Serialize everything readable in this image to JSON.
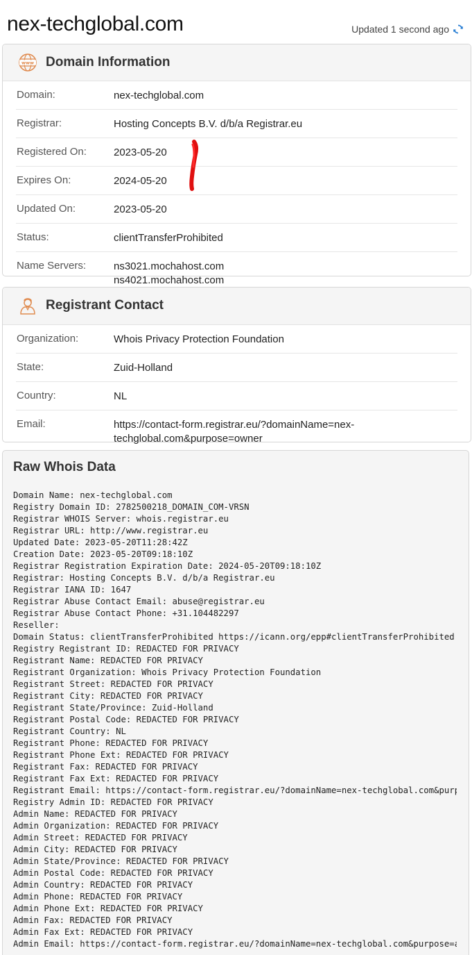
{
  "header": {
    "domain": "nex-techglobal.com",
    "updated_text": "Updated 1 second ago",
    "refresh_icon": "refresh-icon",
    "accent_color": "#2a7fd4"
  },
  "domain_info": {
    "title": "Domain Information",
    "icon": "www-globe-icon",
    "rows": [
      {
        "label": "Domain:",
        "value": "nex-techglobal.com"
      },
      {
        "label": "Registrar:",
        "value": "Hosting Concepts B.V. d/b/a Registrar.eu"
      },
      {
        "label": "Registered On:",
        "value": "2023-05-20"
      },
      {
        "label": "Expires On:",
        "value": "2024-05-20"
      },
      {
        "label": "Updated On:",
        "value": "2023-05-20"
      },
      {
        "label": "Status:",
        "value": "clientTransferProhibited"
      },
      {
        "label": "Name Servers:",
        "value": "ns3021.mochahost.com",
        "value2": "ns4021.mochahost.com"
      }
    ]
  },
  "registrant": {
    "title": "Registrant Contact",
    "icon": "user-icon",
    "rows": [
      {
        "label": "Organization:",
        "value": "Whois Privacy Protection Foundation"
      },
      {
        "label": "State:",
        "value": "Zuid-Holland"
      },
      {
        "label": "Country:",
        "value": "NL"
      },
      {
        "label": "Email:",
        "value": "https://contact-form.registrar.eu/?domainName=nex-",
        "value2": "techglobal.com&purpose=owner"
      }
    ]
  },
  "raw": {
    "title": "Raw Whois Data",
    "lines": [
      "Domain Name: nex-techglobal.com",
      "Registry Domain ID: 2782500218_DOMAIN_COM-VRSN",
      "Registrar WHOIS Server: whois.registrar.eu",
      "Registrar URL: http://www.registrar.eu",
      "Updated Date: 2023-05-20T11:28:42Z",
      "Creation Date: 2023-05-20T09:18:10Z",
      "Registrar Registration Expiration Date: 2024-05-20T09:18:10Z",
      "Registrar: Hosting Concepts B.V. d/b/a Registrar.eu",
      "Registrar IANA ID: 1647",
      "Registrar Abuse Contact Email: abuse@registrar.eu",
      "Registrar Abuse Contact Phone: +31.104482297",
      "Reseller:",
      "Domain Status: clientTransferProhibited https://icann.org/epp#clientTransferProhibited",
      "Registry Registrant ID: REDACTED FOR PRIVACY",
      "Registrant Name: REDACTED FOR PRIVACY",
      "Registrant Organization: Whois Privacy Protection Foundation",
      "Registrant Street: REDACTED FOR PRIVACY",
      "Registrant City: REDACTED FOR PRIVACY",
      "Registrant State/Province: Zuid-Holland",
      "Registrant Postal Code: REDACTED FOR PRIVACY",
      "Registrant Country: NL",
      "Registrant Phone: REDACTED FOR PRIVACY",
      "Registrant Phone Ext: REDACTED FOR PRIVACY",
      "Registrant Fax: REDACTED FOR PRIVACY",
      "Registrant Fax Ext: REDACTED FOR PRIVACY",
      "Registrant Email: https://contact-form.registrar.eu/?domainName=nex-techglobal.com&purpose=owner",
      "Registry Admin ID: REDACTED FOR PRIVACY",
      "Admin Name: REDACTED FOR PRIVACY",
      "Admin Organization: REDACTED FOR PRIVACY",
      "Admin Street: REDACTED FOR PRIVACY",
      "Admin City: REDACTED FOR PRIVACY",
      "Admin State/Province: REDACTED FOR PRIVACY",
      "Admin Postal Code: REDACTED FOR PRIVACY",
      "Admin Country: REDACTED FOR PRIVACY",
      "Admin Phone: REDACTED FOR PRIVACY",
      "Admin Phone Ext: REDACTED FOR PRIVACY",
      "Admin Fax: REDACTED FOR PRIVACY",
      "Admin Fax Ext: REDACTED FOR PRIVACY",
      "Admin Email: https://contact-form.registrar.eu/?domainName=nex-techglobal.com&purpose=admin"
    ]
  }
}
